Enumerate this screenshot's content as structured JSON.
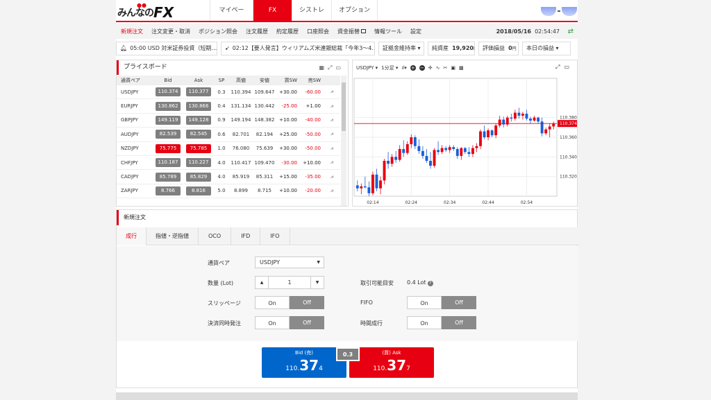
{
  "logo": {
    "text": "みんなの",
    "fx": "FX"
  },
  "tabs": [
    "マイページ",
    "FX",
    "シストレ",
    "オプション"
  ],
  "submenu": [
    "新規注文",
    "注文変更・取消",
    "ポジション照会",
    "注文履歴",
    "約定履歴",
    "口座照会",
    "資金振替",
    "情報ツール",
    "設定"
  ],
  "datetime": {
    "date": "2018/05/16",
    "time": "02:54:47"
  },
  "ticker": {
    "news1": "05:00 USD 対米証券投資（短期…",
    "news2": "02:12【要人発言】ウィリアムズ米連銀総裁「今年3～4…",
    "margin_label": "証拠金維持率",
    "equity_label": "純資産",
    "equity_value": "19,920",
    "equity_unit": "円",
    "pl_label": "評価損益",
    "pl_value": "0",
    "pl_unit": "円",
    "today_label": "本日の損益"
  },
  "priceboard": {
    "title": "プライスボード",
    "headers": [
      "通貨ペア",
      "Bid",
      "Ask",
      "SP",
      "高値",
      "安値",
      "買SW",
      "売SW"
    ],
    "rows": [
      {
        "pair": "USDJPY",
        "bid": "110.374",
        "ask": "110.377",
        "sp": "0.3",
        "high": "110.394",
        "low": "109.647",
        "buysw": "+30.00",
        "sellsw": "-60.00"
      },
      {
        "pair": "EURJPY",
        "bid": "130.862",
        "ask": "130.866",
        "sp": "0.4",
        "high": "131.134",
        "low": "130.442",
        "buysw": "-25.00",
        "sellsw": "+1.00"
      },
      {
        "pair": "GBPJPY",
        "bid": "149.119",
        "ask": "149.128",
        "sp": "0.9",
        "high": "149.194",
        "low": "148.382",
        "buysw": "+10.00",
        "sellsw": "-40.00"
      },
      {
        "pair": "AUDJPY",
        "bid": "82.539",
        "ask": "82.545",
        "sp": "0.6",
        "high": "82.701",
        "low": "82.194",
        "buysw": "+25.00",
        "sellsw": "-50.00"
      },
      {
        "pair": "NZDJPY",
        "bid": "75.775",
        "ask": "75.785",
        "sp": "1.0",
        "high": "76.080",
        "low": "75.639",
        "buysw": "+30.00",
        "sellsw": "-50.00",
        "up": true
      },
      {
        "pair": "CHFJPY",
        "bid": "110.187",
        "ask": "110.227",
        "sp": "4.0",
        "high": "110.417",
        "low": "109.470",
        "buysw": "-30.00",
        "sellsw": "+10.00"
      },
      {
        "pair": "CADJPY",
        "bid": "85.789",
        "ask": "85.829",
        "sp": "4.0",
        "high": "85.919",
        "low": "85.311",
        "buysw": "+15.00",
        "sellsw": "-35.00"
      },
      {
        "pair": "ZARJPY",
        "bid": "8.766",
        "ask": "8.816",
        "sp": "5.0",
        "high": "8.899",
        "low": "8.715",
        "buysw": "+10.00",
        "sellsw": "-20.00"
      }
    ]
  },
  "chart": {
    "pair": "USDJPY",
    "interval": "1分足",
    "current_price": "110.374",
    "price_labels": [
      "110.380",
      "110.360",
      "110.340",
      "110.320"
    ],
    "time_labels": [
      "02:14",
      "02:24",
      "02:34",
      "02:44",
      "02:54"
    ]
  },
  "chart_data": {
    "type": "candlestick",
    "ylim": [
      110.3,
      110.42
    ],
    "current": 110.374,
    "candles": [
      {
        "o": 110.311,
        "h": 110.316,
        "l": 110.305,
        "c": 110.308
      },
      {
        "o": 110.308,
        "h": 110.313,
        "l": 110.302,
        "c": 110.31
      },
      {
        "o": 110.31,
        "h": 110.32,
        "l": 110.308,
        "c": 110.309
      },
      {
        "o": 110.309,
        "h": 110.315,
        "l": 110.3,
        "c": 110.303
      },
      {
        "o": 110.303,
        "h": 110.325,
        "l": 110.301,
        "c": 110.322
      },
      {
        "o": 110.322,
        "h": 110.328,
        "l": 110.305,
        "c": 110.308
      },
      {
        "o": 110.308,
        "h": 110.32,
        "l": 110.302,
        "c": 110.316
      },
      {
        "o": 110.316,
        "h": 110.338,
        "l": 110.312,
        "c": 110.336
      },
      {
        "o": 110.336,
        "h": 110.345,
        "l": 110.328,
        "c": 110.333
      },
      {
        "o": 110.333,
        "h": 110.343,
        "l": 110.33,
        "c": 110.34
      },
      {
        "o": 110.34,
        "h": 110.346,
        "l": 110.334,
        "c": 110.337
      },
      {
        "o": 110.337,
        "h": 110.352,
        "l": 110.335,
        "c": 110.348
      },
      {
        "o": 110.348,
        "h": 110.357,
        "l": 110.34,
        "c": 110.344
      },
      {
        "o": 110.344,
        "h": 110.356,
        "l": 110.342,
        "c": 110.353
      },
      {
        "o": 110.353,
        "h": 110.363,
        "l": 110.349,
        "c": 110.36
      },
      {
        "o": 110.36,
        "h": 110.362,
        "l": 110.348,
        "c": 110.351
      },
      {
        "o": 110.351,
        "h": 110.358,
        "l": 110.343,
        "c": 110.346
      },
      {
        "o": 110.346,
        "h": 110.351,
        "l": 110.338,
        "c": 110.341
      },
      {
        "o": 110.341,
        "h": 110.348,
        "l": 110.334,
        "c": 110.336
      },
      {
        "o": 110.336,
        "h": 110.345,
        "l": 110.328,
        "c": 110.331
      },
      {
        "o": 110.331,
        "h": 110.349,
        "l": 110.329,
        "c": 110.347
      },
      {
        "o": 110.347,
        "h": 110.356,
        "l": 110.342,
        "c": 110.345
      },
      {
        "o": 110.345,
        "h": 110.352,
        "l": 110.343,
        "c": 110.349
      },
      {
        "o": 110.349,
        "h": 110.351,
        "l": 110.345,
        "c": 110.347
      },
      {
        "o": 110.347,
        "h": 110.352,
        "l": 110.344,
        "c": 110.35
      },
      {
        "o": 110.35,
        "h": 110.352,
        "l": 110.346,
        "c": 110.348
      },
      {
        "o": 110.348,
        "h": 110.35,
        "l": 110.338,
        "c": 110.341
      },
      {
        "o": 110.341,
        "h": 110.35,
        "l": 110.337,
        "c": 110.349
      },
      {
        "o": 110.349,
        "h": 110.35,
        "l": 110.343,
        "c": 110.345
      },
      {
        "o": 110.345,
        "h": 110.35,
        "l": 110.34,
        "c": 110.343
      },
      {
        "o": 110.343,
        "h": 110.352,
        "l": 110.34,
        "c": 110.349
      },
      {
        "o": 110.349,
        "h": 110.354,
        "l": 110.345,
        "c": 110.351
      },
      {
        "o": 110.351,
        "h": 110.368,
        "l": 110.348,
        "c": 110.366
      },
      {
        "o": 110.366,
        "h": 110.372,
        "l": 110.358,
        "c": 110.36
      },
      {
        "o": 110.36,
        "h": 110.369,
        "l": 110.357,
        "c": 110.367
      },
      {
        "o": 110.367,
        "h": 110.368,
        "l": 110.36,
        "c": 110.362
      },
      {
        "o": 110.362,
        "h": 110.374,
        "l": 110.359,
        "c": 110.372
      },
      {
        "o": 110.372,
        "h": 110.382,
        "l": 110.37,
        "c": 110.378
      },
      {
        "o": 110.378,
        "h": 110.381,
        "l": 110.37,
        "c": 110.373
      },
      {
        "o": 110.373,
        "h": 110.382,
        "l": 110.371,
        "c": 110.38
      },
      {
        "o": 110.38,
        "h": 110.384,
        "l": 110.376,
        "c": 110.379
      },
      {
        "o": 110.379,
        "h": 110.388,
        "l": 110.377,
        "c": 110.385
      },
      {
        "o": 110.385,
        "h": 110.39,
        "l": 110.379,
        "c": 110.382
      },
      {
        "o": 110.382,
        "h": 110.386,
        "l": 110.378,
        "c": 110.384
      },
      {
        "o": 110.384,
        "h": 110.388,
        "l": 110.377,
        "c": 110.379
      },
      {
        "o": 110.379,
        "h": 110.381,
        "l": 110.374,
        "c": 110.377
      },
      {
        "o": 110.377,
        "h": 110.382,
        "l": 110.376,
        "c": 110.38
      },
      {
        "o": 110.38,
        "h": 110.381,
        "l": 110.374,
        "c": 110.376
      },
      {
        "o": 110.376,
        "h": 110.38,
        "l": 110.361,
        "c": 110.364
      },
      {
        "o": 110.364,
        "h": 110.37,
        "l": 110.362,
        "c": 110.368
      },
      {
        "o": 110.368,
        "h": 110.374,
        "l": 110.36,
        "c": 110.371
      },
      {
        "o": 110.371,
        "h": 110.376,
        "l": 110.368,
        "c": 110.374
      }
    ]
  },
  "order": {
    "title": "新規注文",
    "tabs": [
      "成行",
      "指値・逆指値",
      "OCO",
      "IFD",
      "IFO"
    ],
    "pair_label": "通貨ペア",
    "pair_value": "USDJPY",
    "qty_label": "数量 (Lot)",
    "qty_value": "1",
    "slip_label": "スリッページ",
    "close_label": "決済同時発注",
    "avail_label": "取引可能目安",
    "avail_value": "0.4 Lot",
    "fifo_label": "FIFO",
    "time_label": "時間成行",
    "on": "On",
    "off": "Off",
    "bid_label": "Bid (売)",
    "bid_a": "110.",
    "bid_b": "37",
    "bid_c": "4",
    "ask_label": "(買) Ask",
    "ask_a": "110.",
    "ask_b": "37",
    "ask_c": "7",
    "spread": "0.3"
  },
  "colors": {
    "accent": "#e60012",
    "bid": "#0066cc",
    "up": "#e60012",
    "down": "#1a5fd6"
  }
}
